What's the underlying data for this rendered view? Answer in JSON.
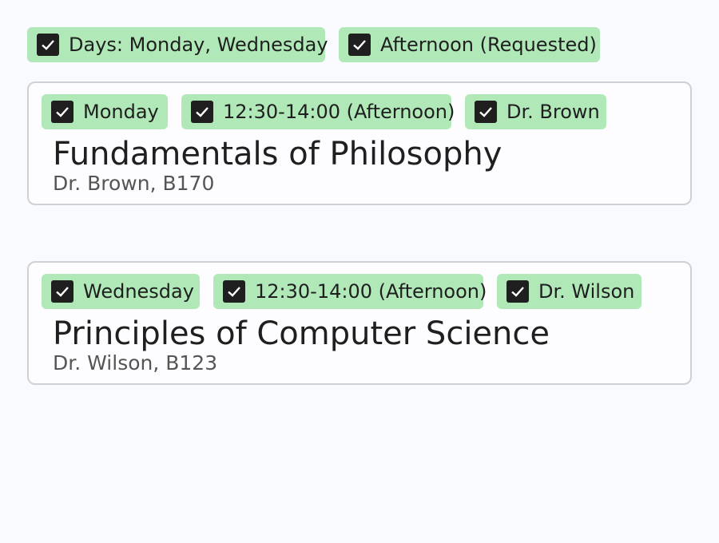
{
  "filters": [
    {
      "label": "Days: Monday, Wednesday",
      "checked": true
    },
    {
      "label": "Afternoon (Requested)",
      "checked": true
    }
  ],
  "courses": [
    {
      "tags": [
        {
          "label": "Monday",
          "checked": true
        },
        {
          "label": "12:30-14:00 (Afternoon)",
          "checked": true
        },
        {
          "label": "Dr. Brown",
          "checked": true
        }
      ],
      "title": "Fundamentals of Philosophy",
      "subtitle": "Dr. Brown, B170"
    },
    {
      "tags": [
        {
          "label": "Wednesday",
          "checked": true
        },
        {
          "label": "12:30-14:00 (Afternoon)",
          "checked": true
        },
        {
          "label": "Dr. Wilson",
          "checked": true
        }
      ],
      "title": "Principles of Computer Science",
      "subtitle": "Dr. Wilson, B123"
    }
  ],
  "colors": {
    "tag_bg": "#b0e8b8",
    "checkbox": "#1f1f1f",
    "page_bg": "#f9faff"
  }
}
